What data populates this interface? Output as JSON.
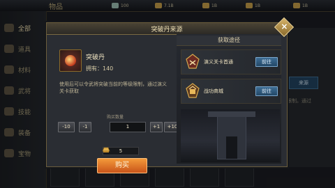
{
  "topbar": {
    "title": "物品",
    "resources": [
      {
        "icon": "jade-icon",
        "value": "100"
      },
      {
        "icon": "coin-icon",
        "value": "7.1B"
      },
      {
        "icon": "gold-ingot-icon",
        "value": "1B"
      },
      {
        "icon": "scroll-icon",
        "value": "1B"
      },
      {
        "icon": "seal-icon",
        "value": "1B"
      }
    ]
  },
  "sidebar": {
    "items": [
      {
        "label": "全部",
        "icon": "all-icon"
      },
      {
        "label": "道具",
        "icon": "bag-icon"
      },
      {
        "label": "材料",
        "icon": "material-icon"
      },
      {
        "label": "武将",
        "icon": "general-icon"
      },
      {
        "label": "技能",
        "icon": "book-icon"
      },
      {
        "label": "装备",
        "icon": "swords-icon"
      },
      {
        "label": "宝物",
        "icon": "treasure-icon"
      }
    ]
  },
  "background": {
    "source_button": "来源",
    "hint_text": "级限制。通过"
  },
  "dialog": {
    "title": "突破丹来源",
    "item": {
      "name": "突破丹",
      "owned": "拥有：140",
      "description": "使用后可以令武将突破当前的等级限制，通过演义关卡获取"
    },
    "quantity": {
      "label": "购买数量",
      "minus10": "-10",
      "minus1": "-1",
      "value": "1",
      "plus1": "+1",
      "plus10": "+10"
    },
    "price": "5",
    "buy_label": "购买",
    "sources": {
      "header": "获取途径",
      "rows": [
        {
          "label": "演义关卡首通",
          "button": "前往",
          "icon": "stage-icon"
        },
        {
          "label": "战功商城",
          "button": "前往",
          "icon": "shop-icon"
        }
      ]
    },
    "close_label": "×"
  },
  "colors": {
    "accent_gold": "#d7b46a",
    "buy_orange": "#f39a3a",
    "goto_blue": "#3e6d95"
  }
}
